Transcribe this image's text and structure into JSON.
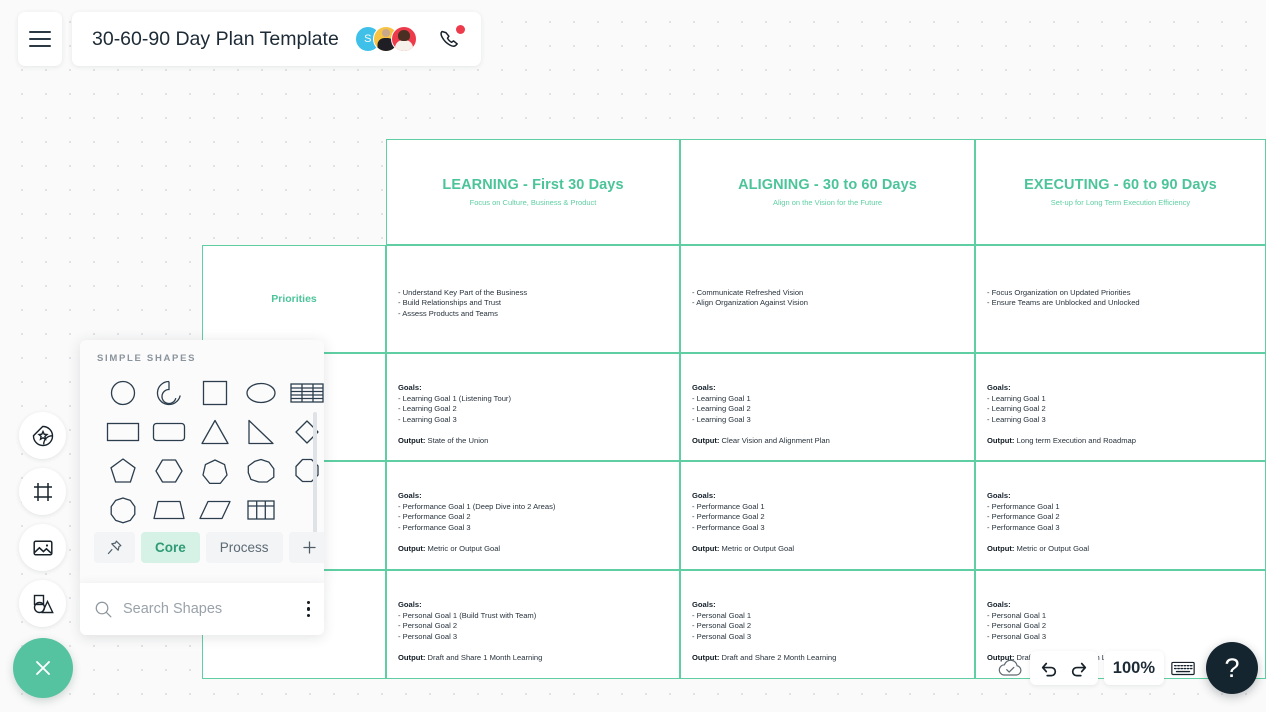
{
  "header": {
    "menu_icon": "hamburger-icon",
    "title": "30-60-90 Day Plan Template",
    "avatars": [
      {
        "name": "avatar-s",
        "initial": "S",
        "color": "#3ec0e8"
      },
      {
        "name": "avatar-person-2",
        "initial": "",
        "color": "#f6c344"
      },
      {
        "name": "avatar-person-3",
        "initial": "",
        "color": "#ee3b4b"
      }
    ],
    "call_icon": "phone-call-icon",
    "call_badge": true
  },
  "left_rail": {
    "items": [
      {
        "name": "sticker-icon",
        "label": "Stickers"
      },
      {
        "name": "frame-icon",
        "label": "Frame"
      },
      {
        "name": "image-icon",
        "label": "Image"
      },
      {
        "name": "shapes-icon",
        "label": "Shapes"
      }
    ],
    "close_button": {
      "name": "close-icon",
      "label": "Close",
      "color": "#55c2a0"
    }
  },
  "shapes_panel": {
    "section_title": "SIMPLE SHAPES",
    "shapes": [
      "circle-shape",
      "arc-shape",
      "square-shape",
      "ellipse-shape",
      "table-rows-shape",
      "rectangle-shape",
      "rounded-rectangle-shape",
      "triangle-shape",
      "right-triangle-shape",
      "diamond-shape",
      "pentagon-shape",
      "hexagon-shape",
      "heptagon-shape",
      "nonagon-shape",
      "octagon-shape",
      "decagon-shape",
      "trapezoid-shape",
      "parallelogram-shape",
      "grid-table-shape"
    ],
    "tabs": [
      {
        "name": "pin-tab",
        "label": "",
        "icon": "pin-icon",
        "active": false
      },
      {
        "name": "core-tab",
        "label": "Core",
        "active": true
      },
      {
        "name": "process-tab",
        "label": "Process",
        "active": false
      },
      {
        "name": "add-tab",
        "label": "+",
        "active": false
      }
    ],
    "search": {
      "icon": "search-icon",
      "placeholder": "Search Shapes",
      "value": "",
      "menu_icon": "kebab-menu-icon"
    }
  },
  "bottom_toolbar": {
    "saved_icon": "cloud-check-icon",
    "undo_icon": "undo-icon",
    "redo_icon": "redo-icon",
    "zoom_level": "100%",
    "keyboard_icon": "keyboard-icon",
    "help_label": "?"
  },
  "board": {
    "accent": "#5fcfa3",
    "columns": [
      {
        "title": "LEARNING - First 30 Days",
        "subtitle": "Focus on Culture, Business & Product"
      },
      {
        "title": "ALIGNING - 30 to 60 Days",
        "subtitle": "Align on the Vision for the Future"
      },
      {
        "title": "EXECUTING - 60 to 90 Days",
        "subtitle": "Set-up for Long Term Execution Efficiency"
      }
    ],
    "row_labels": [
      "Priorities",
      "",
      "",
      ""
    ],
    "rows": [
      {
        "label": "Priorities",
        "cells": [
          {
            "goals_label": "",
            "bullets": [
              "- Understand Key Part of the Business",
              "- Build Relationships and Trust",
              "- Assess Products and Teams"
            ],
            "output_label": "",
            "output_value": ""
          },
          {
            "goals_label": "",
            "bullets": [
              "- Communicate Refreshed Vision",
              "- Align Organization Against Vision"
            ],
            "output_label": "",
            "output_value": ""
          },
          {
            "goals_label": "",
            "bullets": [
              "- Focus Organization on Updated Priorities",
              "- Ensure Teams are Unblocked and Unlocked"
            ],
            "output_label": "",
            "output_value": ""
          }
        ]
      },
      {
        "label": "",
        "cells": [
          {
            "goals_label": "Goals:",
            "bullets": [
              "- Learning Goal 1 (Listening Tour)",
              "- Learning Goal 2",
              "- Learning Goal 3"
            ],
            "output_label": "Output:",
            "output_value": "State of the Union"
          },
          {
            "goals_label": "Goals:",
            "bullets": [
              "- Learning Goal 1",
              "- Learning Goal 2",
              "- Learning Goal 3"
            ],
            "output_label": "Output:",
            "output_value": "Clear Vision and Alignment Plan"
          },
          {
            "goals_label": "Goals:",
            "bullets": [
              "- Learning Goal 1",
              "- Learning Goal 2",
              "- Learning Goal 3"
            ],
            "output_label": "Output:",
            "output_value": "Long term Execution and Roadmap"
          }
        ]
      },
      {
        "label": "",
        "cells": [
          {
            "goals_label": "Goals:",
            "bullets": [
              "- Performance Goal 1 (Deep Dive into 2 Areas)",
              "- Performance Goal 2",
              "- Performance Goal 3"
            ],
            "output_label": "Output:",
            "output_value": "Metric or Output Goal"
          },
          {
            "goals_label": "Goals:",
            "bullets": [
              "- Performance Goal 1",
              "- Performance Goal 2",
              "- Performance Goal 3"
            ],
            "output_label": "Output:",
            "output_value": "Metric or Output Goal"
          },
          {
            "goals_label": "Goals:",
            "bullets": [
              "- Performance Goal 1",
              "- Performance Goal 2",
              "- Performance Goal 3"
            ],
            "output_label": "Output:",
            "output_value": "Metric or Output Goal"
          }
        ]
      },
      {
        "label": "",
        "cells": [
          {
            "goals_label": "Goals:",
            "bullets": [
              "- Personal Goal 1 (Build Trust with Team)",
              "- Personal Goal 2",
              "- Personal Goal 3"
            ],
            "output_label": "Output:",
            "output_value": "Draft and Share 1 Month Learning"
          },
          {
            "goals_label": "Goals:",
            "bullets": [
              "- Personal Goal 1",
              "- Personal Goal 2",
              "- Personal Goal 3"
            ],
            "output_label": "Output:",
            "output_value": "Draft and Share 2 Month Learning"
          },
          {
            "goals_label": "Goals:",
            "bullets": [
              "- Personal Goal 1",
              "- Personal Goal 2",
              "- Personal Goal 3"
            ],
            "output_label": "Output:",
            "output_value": "Draft and Share 3 Month Learning"
          }
        ]
      }
    ]
  }
}
